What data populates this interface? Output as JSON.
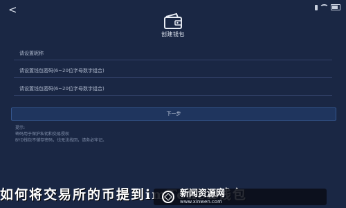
{
  "header": {
    "back_icon": "<",
    "title": "创建钱包"
  },
  "form": {
    "name_placeholder": "请设置昵称",
    "password_placeholder": "请设置钱包密码(6~20位字母数字组合)",
    "confirm_placeholder": "请设置钱包密码(6~20位字母数字组合)"
  },
  "next_button": "下一步",
  "tips": {
    "heading": "提示:",
    "line1": "密码用于保护私钥和交易授权",
    "line2": "BYD钱包不储存密码，也无法找回，请务必牢记。"
  },
  "overlay": {
    "text": "如何将交易所的币提到imToken钱包",
    "watermark_title": "新闻资源网",
    "watermark_sub": "www.xinwen.com"
  },
  "colors": {
    "background": "#1a2744",
    "button_bg": "#1f355e",
    "field_line": "#33426a"
  }
}
